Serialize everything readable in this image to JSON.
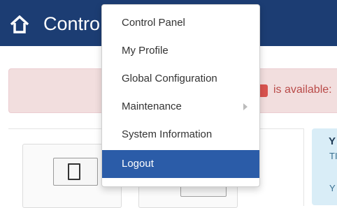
{
  "header": {
    "title": "Contro",
    "icon": "home-icon",
    "background": "#1c3d73"
  },
  "alert": {
    "text": "is available:",
    "background": "#f2dede"
  },
  "info_panel": {
    "title": "Y",
    "line1": "TI",
    "line2": "Y"
  },
  "dropdown": {
    "items": [
      {
        "label": "Control Panel"
      },
      {
        "label": "My Profile"
      },
      {
        "label": "Global Configuration"
      },
      {
        "label": "Maintenance",
        "has_submenu": true
      },
      {
        "label": "System Information"
      },
      {
        "label": "Logout",
        "active": true
      }
    ],
    "active_color": "#2b5ca8"
  },
  "tiles": {
    "icon1": "switch-icon",
    "icon2": "monitor-icon"
  }
}
